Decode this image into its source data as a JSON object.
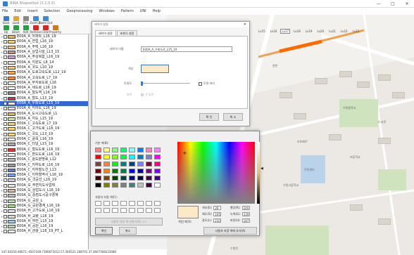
{
  "window": {
    "title": "BINA Shapeditor (3.1.0.0)",
    "controls": [
      "—",
      "□",
      "✕"
    ]
  },
  "menu": [
    "File",
    "Edit",
    "Insert",
    "Selection",
    "Geoprocessing",
    "Windows",
    "Pattern",
    "UNI",
    "Help"
  ],
  "toolbar": {
    "row1": [
      {
        "label": "Save",
        "color": "#3b78c8",
        "icon": "save-icon"
      },
      {
        "label": "Load",
        "color": "#d9a43a",
        "icon": "folder-icon"
      },
      {
        "label": "Pan",
        "color": "#888888",
        "icon": "hand-icon"
      },
      {
        "label": "Zoom In",
        "color": "#3a8ad9",
        "icon": "zoom-in-icon"
      },
      {
        "label": "Zoom Out",
        "color": "#3a8ad9",
        "icon": "zoom-out-icon"
      }
    ],
    "row2": [
      {
        "label": "Up",
        "color": "#2e9c46",
        "icon": "arrow-up-icon"
      },
      {
        "label": "Down",
        "color": "#2e9c46",
        "icon": "arrow-down-icon"
      },
      {
        "label": "Add",
        "color": "#2e9c46",
        "icon": "plus-icon"
      },
      {
        "label": "Remove",
        "color": "#d22",
        "icon": "x-icon"
      },
      {
        "label": "Clear",
        "color": "#d22",
        "icon": "clear-icon"
      },
      {
        "label": "Property",
        "color": "#cc7a22",
        "icon": "gear-icon"
      }
    ]
  },
  "layers": [
    {
      "name": "E00A_A_아파트_L16_19",
      "color": "#f2b24c"
    },
    {
      "name": "E00A_A_연립_L16_19",
      "color": "#f0d088"
    },
    {
      "name": "E00A_A_주택_L16_19",
      "color": "#e8c48a"
    },
    {
      "name": "E00A_A_상업시설_L13_15",
      "color": "#d48a80"
    },
    {
      "name": "E00A_A_주상복합_L16_19",
      "color": "#c9a0c8"
    },
    {
      "name": "E00A_A_지원도_L8_14",
      "color": "#e0e0e0"
    },
    {
      "name": "E00A_A_국도_L10_19",
      "color": "#f6d35c"
    },
    {
      "name": "E00A_A_도로고속도로_L12_19",
      "color": "#f4a460"
    },
    {
      "name": "E00A_A_고속도로_L7_19",
      "color": "#ee8844"
    },
    {
      "name": "E00A_A_무지로도로_L16",
      "color": "#ffffff"
    },
    {
      "name": "E00A_A_세도로_L16_19",
      "color": "#f5f5f5"
    },
    {
      "name": "E00A_A_철도역_L16_19",
      "color": "#888888"
    },
    {
      "name": "E00A_A_철도_L13_19",
      "color": "#d33434"
    },
    {
      "name": "E00A_A_우회도로_L15_19",
      "color": "#fbe9c8",
      "selected": true
    },
    {
      "name": "E00A_A_지하도_L16_19",
      "color": "#dddddd"
    },
    {
      "name": "E00A_A_도시고속도로_L1",
      "color": "#f0b050"
    },
    {
      "name": "E00A_A_지도_L15_19",
      "color": "#cfe0b8"
    },
    {
      "name": "E00A_C_고속도로_L7_19",
      "color": "#ffcc66"
    },
    {
      "name": "E00A_C_고가도로_L16_19",
      "color": "#f5d77a"
    },
    {
      "name": "E00A_C_국도_L13_19",
      "color": "#fdd988"
    },
    {
      "name": "E00A_C_골목_L16_19",
      "color": "#ffffff"
    },
    {
      "name": "E00A_C_터널_L15_19",
      "color": "#aaaaaa"
    },
    {
      "name": "E00A_C_철도도로_L16_19",
      "color": "#d03a3a"
    },
    {
      "name": "E00A_C_편도도로_L16_19",
      "color": "#eeeeee"
    },
    {
      "name": "E00A_C_광도분명로_L12",
      "color": "#bbbbbb"
    },
    {
      "name": "E00A_C_지하도로_L16_19",
      "color": "#999999"
    },
    {
      "name": "E00A_C_지하철노선_L13",
      "color": "#5a7fd0"
    },
    {
      "name": "E00A_C_지하철역사_L16_19",
      "color": "#7a9be0"
    },
    {
      "name": "E00A_G_국공선_L16_19",
      "color": "#cccccc"
    },
    {
      "name": "E00A_G_주변지도사업체",
      "color": "#e6e6e6"
    },
    {
      "name": "E00A_G_상업도시_L16_19",
      "color": "#d6b8a8"
    },
    {
      "name": "E00A_G_중점도시공구경계",
      "color": "#c0c0c0"
    },
    {
      "name": "E00A_G_공원_L",
      "color": "#b8dca0"
    },
    {
      "name": "E00A_G_공원경계_L16_19",
      "color": "#a8d090"
    },
    {
      "name": "E00A_H_고가도로_L16_19",
      "color": "#e0e0e0"
    },
    {
      "name": "E00A_H_교량_L16_19",
      "color": "#d8d8d8"
    },
    {
      "name": "E00A_H_하천_L15_19",
      "color": "#9fc8e8"
    },
    {
      "name": "E00A_H_공원_L16_19",
      "color": "#b0d8a0"
    },
    {
      "name": "E00A_H_관광_L16_19_PT_L",
      "color": "#f0f0f0"
    }
  ],
  "zoom": {
    "levels": [
      "Lv15",
      "Lv16",
      "Lv17",
      "Lv18",
      "Lv19",
      "Lv20",
      "Lv21",
      "Lv22",
      "Lv23"
    ],
    "active": "Lv17"
  },
  "layer_dialog": {
    "title": "레이어 설정",
    "tabs": [
      "레이어 설정",
      "표현식 설정"
    ],
    "name_label": "레이어 이름",
    "name_value": "E00A_A_우회도로_L15_19",
    "color_label": "색상",
    "color_value": "#fbe9c8",
    "opacity_label": "투명도",
    "transparent_label": "투명 처리",
    "width_label": "외곽",
    "line_label": "선 굵기",
    "ok": "확 인",
    "cancel": "취 소"
  },
  "color_dialog": {
    "basic_label": "기본 색(B):",
    "custom_label": "사용자 지정 색(C):",
    "define_button": "사용자 지정 색 만들기(D) >>",
    "ok": "확인",
    "cancel": "취소",
    "add_button": "사용자 지정 색에 추가(A)",
    "color_solid_label": "색|단색(O)",
    "current_color": "#fbe9c8",
    "fields": [
      {
        "label": "색조(E):",
        "value": "29"
      },
      {
        "label": "채도(S):",
        "value": "195"
      },
      {
        "label": "광도(L):",
        "value": "210"
      },
      {
        "label": "빨강(R):",
        "value": "249"
      },
      {
        "label": "녹색(G):",
        "value": "229"
      },
      {
        "label": "파랑(U):",
        "value": "187"
      }
    ],
    "basic": [
      "#ff8080",
      "#ffff80",
      "#80ff80",
      "#00ff80",
      "#80ffff",
      "#0080ff",
      "#ff80c0",
      "#ff80ff",
      "#ff0000",
      "#ffff00",
      "#80ff00",
      "#00ff40",
      "#00ffff",
      "#0080c0",
      "#8080c0",
      "#ff00ff",
      "#804040",
      "#ff8040",
      "#00ff00",
      "#008080",
      "#004080",
      "#8080ff",
      "#800040",
      "#ff0080",
      "#800000",
      "#ff8000",
      "#008000",
      "#008040",
      "#0000ff",
      "#0000a0",
      "#800080",
      "#8000ff",
      "#400000",
      "#804000",
      "#004000",
      "#004040",
      "#000080",
      "#000040",
      "#400040",
      "#400080",
      "#000000",
      "#808000",
      "#808040",
      "#808080",
      "#408080",
      "#c0c0c0",
      "#400040",
      "#ffffff"
    ]
  },
  "map": {
    "labels": [
      "조호메르",
      "주민센터",
      "수원중학교",
      "수원고등학교",
      "초등학교",
      "원천",
      "수원연",
      "도서관"
    ]
  },
  "status": "147.40250.46672,-4507169.7366672012.57,340521.168701.37,4607308223080"
}
